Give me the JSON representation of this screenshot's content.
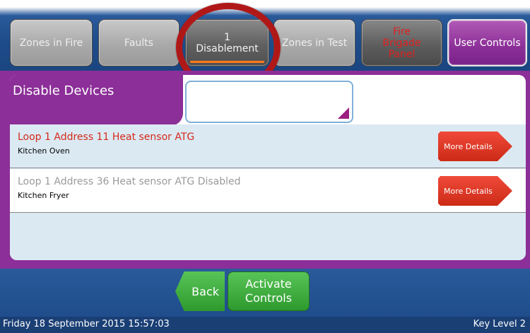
{
  "tabs": [
    {
      "label": "Zones in Fire"
    },
    {
      "label": "Faults"
    },
    {
      "count": "1",
      "label": "Disablement"
    },
    {
      "label": "Zones in Test"
    },
    {
      "label": "Fire\nBrigade\nPanel"
    },
    {
      "label": "User Controls"
    }
  ],
  "page_title": "Disable Devices",
  "devices": [
    {
      "title": "Loop 1 Address 11 Heat sensor ATG",
      "location": "Kitchen Oven",
      "button": "More Details"
    },
    {
      "title": "Loop 1 Address 36 Heat sensor ATG Disabled",
      "location": "Kitchen Fryer",
      "button": "More Details"
    }
  ],
  "nav": {
    "back": "Back",
    "activate": "Activate\nControls"
  },
  "status": {
    "datetime": "Friday 18 September 2015 15:57:03",
    "key_level": "Key Level 2"
  },
  "colors": {
    "accent_purple": "#8c2f98",
    "bar_blue": "#1f4d8c",
    "alert_red": "#d42a1a",
    "button_green": "#2e9a2e",
    "annotation_red": "#b01818"
  },
  "icons": {
    "dropdown": "dropdown-triangle-icon",
    "annotation": "highlight-circle"
  }
}
